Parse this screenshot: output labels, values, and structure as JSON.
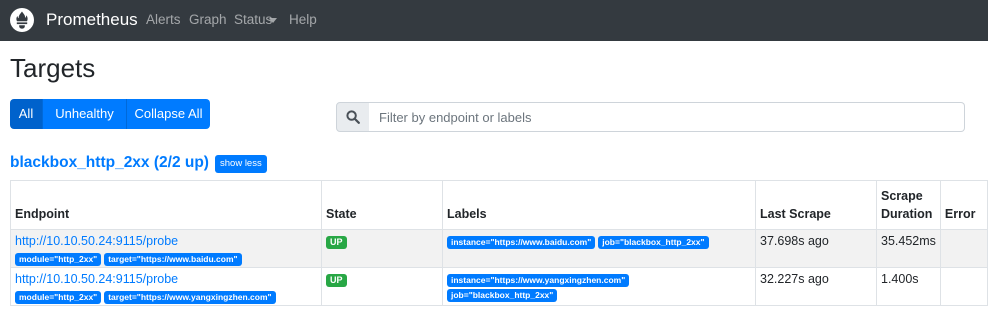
{
  "navbar": {
    "brand": "Prometheus",
    "links": [
      "Alerts",
      "Graph",
      "Status",
      "Help"
    ]
  },
  "page_title": "Targets",
  "filter_buttons": [
    "All",
    "Unhealthy",
    "Collapse All"
  ],
  "active_filter": "All",
  "search": {
    "placeholder": "Filter by endpoint or labels",
    "value": ""
  },
  "job": {
    "title": "blackbox_http_2xx (2/2 up)",
    "toggle_label": "show less"
  },
  "table": {
    "headers": {
      "endpoint": "Endpoint",
      "state": "State",
      "labels": "Labels",
      "last_scrape": "Last Scrape",
      "scrape_duration_1": "Scrape",
      "scrape_duration_2": "Duration",
      "error": "Error"
    },
    "rows": [
      {
        "endpoint": "http://10.10.50.24:9115/probe",
        "params": [
          "module=\"http_2xx\"",
          "target=\"https://www.baidu.com\""
        ],
        "state": "UP",
        "labels": [
          "instance=\"https://www.baidu.com\"",
          "job=\"blackbox_http_2xx\""
        ],
        "last_scrape": "37.698s ago",
        "scrape_duration": "35.452ms",
        "error": ""
      },
      {
        "endpoint": "http://10.10.50.24:9115/probe",
        "params": [
          "module=\"http_2xx\"",
          "target=\"https://www.yangxingzhen.com\""
        ],
        "state": "UP",
        "labels": [
          "instance=\"https://www.yangxingzhen.com\"",
          "job=\"blackbox_http_2xx\""
        ],
        "last_scrape": "32.227s ago",
        "scrape_duration": "1.400s",
        "error": ""
      }
    ]
  },
  "colors": {
    "navbar": "#343a40",
    "primary": "#007bff",
    "success": "#28a745"
  }
}
